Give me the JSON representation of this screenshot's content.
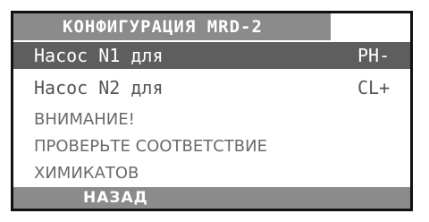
{
  "screen": {
    "title": "КОНФИГУРАЦИЯ MRD-2",
    "pumps": [
      {
        "label": "Насос N1 для",
        "value": "PH-"
      },
      {
        "label": "Насос N2 для",
        "value": "CL+"
      }
    ],
    "warning_lines": [
      "ВНИМАНИЕ!",
      "ПРОВЕРЬТЕ СООТВЕТСТВИЕ",
      "ХИМИКАТОВ"
    ],
    "back_label": "НАЗАД"
  },
  "colors": {
    "title_bg": "#8b8b8b",
    "selected_bg": "#5e5e5e",
    "border": "#111111"
  }
}
